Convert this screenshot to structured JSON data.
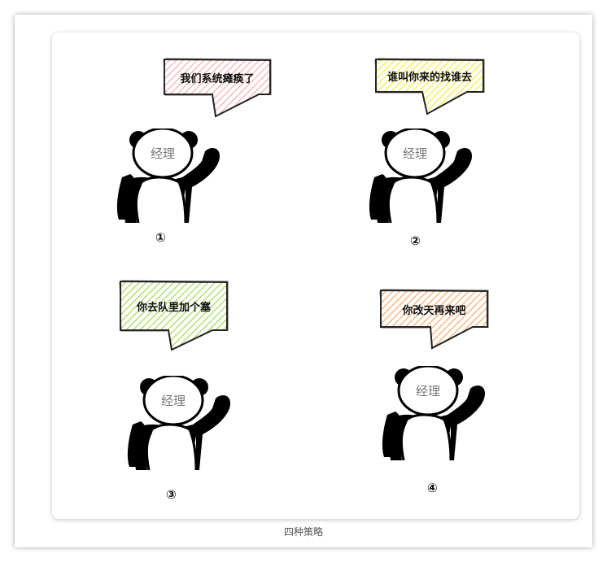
{
  "caption": "四种策略",
  "panels": [
    {
      "speech": "我们系统瘫痪了",
      "fill": "#f4b0b0",
      "head_label": "经理",
      "number": "①"
    },
    {
      "speech": "谁叫你来的找谁去",
      "fill": "#f0ee40",
      "head_label": "经理",
      "number": "②"
    },
    {
      "speech": "你去队里加个塞",
      "fill": "#a6d85a",
      "head_label": "经理",
      "number": "③"
    },
    {
      "speech": "你改天再来吧",
      "fill": "#f8ad6a",
      "head_label": "经理",
      "number": "④"
    }
  ]
}
